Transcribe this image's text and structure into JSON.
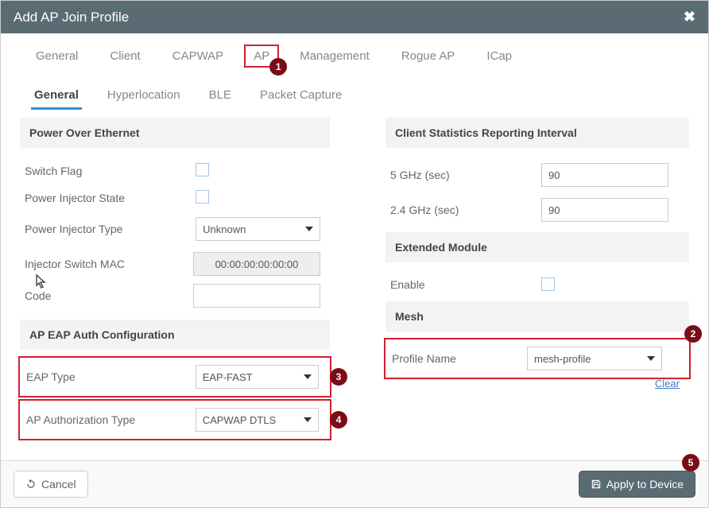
{
  "header": {
    "title": "Add AP Join Profile"
  },
  "tabs_main": [
    "General",
    "Client",
    "CAPWAP",
    "AP",
    "Management",
    "Rogue AP",
    "ICap"
  ],
  "tabs_sub": [
    "General",
    "Hyperlocation",
    "BLE",
    "Packet Capture"
  ],
  "left": {
    "poe_header": "Power Over Ethernet",
    "switch_flag": "Switch Flag",
    "inj_state": "Power Injector State",
    "inj_type": "Power Injector Type",
    "inj_type_val": "Unknown",
    "inj_mac": "Injector Switch MAC",
    "inj_mac_val": "00:00:00:00:00:00",
    "code": "Code",
    "eap_header": "AP EAP Auth Configuration",
    "eap_type": "EAP Type",
    "eap_type_val": "EAP-FAST",
    "auth_type": "AP Authorization Type",
    "auth_type_val": "CAPWAP DTLS"
  },
  "right": {
    "csr_header": "Client Statistics Reporting Interval",
    "ghz5": "5 GHz (sec)",
    "ghz5_val": "90",
    "ghz24": "2.4 GHz (sec)",
    "ghz24_val": "90",
    "ext_header": "Extended Module",
    "enable": "Enable",
    "mesh_header": "Mesh",
    "profile_name": "Profile Name",
    "profile_name_val": "mesh-profile",
    "clear": "Clear"
  },
  "footer": {
    "cancel": "Cancel",
    "apply": "Apply to Device"
  },
  "badges": {
    "b1": "1",
    "b2": "2",
    "b3": "3",
    "b4": "4",
    "b5": "5"
  }
}
